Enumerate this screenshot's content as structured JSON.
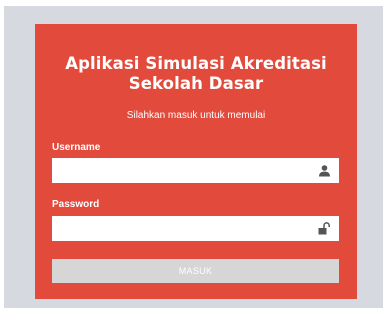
{
  "login": {
    "title_line1": "Aplikasi Simulasi Akreditasi",
    "title_line2": "Sekolah Dasar",
    "subtitle": "Silahkan masuk untuk memulai",
    "username": {
      "label": "Username",
      "value": "",
      "icon": "user-icon"
    },
    "password": {
      "label": "Password",
      "value": "",
      "icon": "lock-icon"
    },
    "submit_label": "MASUK"
  },
  "colors": {
    "panel": "#e24a3b",
    "backdrop": "#d6d9df",
    "button": "#d6d6d6",
    "icon": "#555555"
  }
}
